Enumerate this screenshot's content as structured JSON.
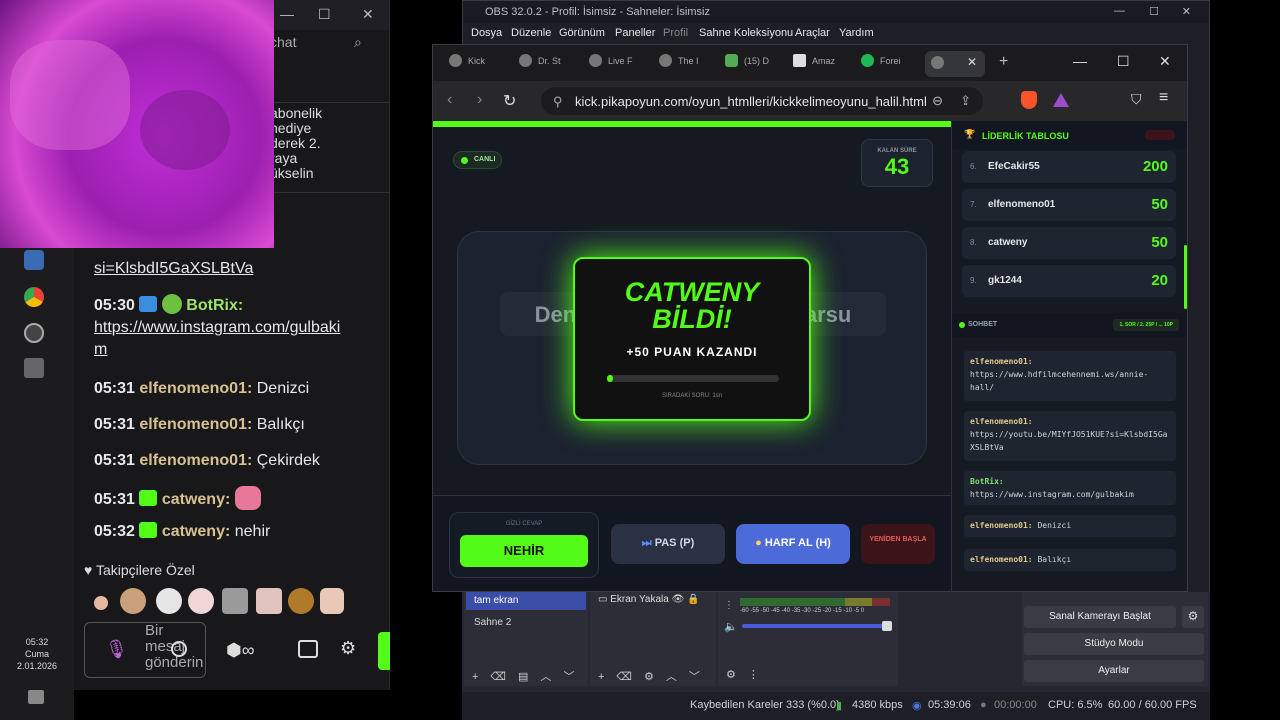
{
  "taskbar": {
    "time": "05:32",
    "day": "Cuma",
    "date": "2.01.2026"
  },
  "chat_panel": {
    "search_placeholder": "chat",
    "notice_lines": [
      "abonelik",
      "hediye",
      "derek 2.",
      "raya",
      "ükselin"
    ],
    "messages": [
      {
        "link": "si=KlsbdI5GaXSLBtVa"
      },
      {
        "time": "05:30",
        "user": "BotRix:",
        "text": "https://www.instagram.com/gulbaki",
        "cont": "m"
      },
      {
        "time": "05:31",
        "user": "elfenomeno01:",
        "text": "Denizci"
      },
      {
        "time": "05:31",
        "user": "elfenomeno01:",
        "text": "Balıkçı"
      },
      {
        "time": "05:31",
        "user": "elfenomeno01:",
        "text": "Çekirdek"
      },
      {
        "time": "05:31",
        "user": "catweny:",
        "text": ""
      },
      {
        "time": "05:32",
        "user": "catweny:",
        "text": "nehir"
      }
    ],
    "followers_label": "Takipçilere Özel",
    "input_placeholder": "Bir mesaj gönderin"
  },
  "obs": {
    "title": "OBS 32.0.2 - Profil: İsimsiz - Sahneler: İsimsiz",
    "menu": [
      "Dosya",
      "Düzenle",
      "Görünüm",
      "Paneller",
      "Profil",
      "Sahne Koleksiyonu",
      "Araçlar",
      "Yardım"
    ],
    "scenes": [
      "tam ekran",
      "Sahne 2"
    ],
    "source": "Ekran Yakala",
    "meter_ticks": "-60 -55 -50 -45 -40 -35 -30 -25 -20 -15 -10 -5 0",
    "controls": [
      "Sanal Kamerayı Başlat",
      "Stüdyo Modu",
      "Ayarlar"
    ],
    "status": {
      "dropped": "Kaybedilen Kareler 333 (%0.0)",
      "bitrate": "4380 kbps",
      "rec_time": "05:39:06",
      "stream_time": "00:00:00",
      "cpu": "CPU: 6.5%",
      "fps": "60.00 / 60.00 FPS"
    }
  },
  "browser": {
    "tabs": [
      "Kick",
      "Dr. St",
      "Live F",
      "The I",
      "(15) D",
      "Amaz",
      "Forei"
    ],
    "url": "kick.pikapoyun.com/oyun_htmlleri/kickkelimeoyunu_halil.html"
  },
  "game": {
    "live_label": "CANLI",
    "time_label": "KALAN SÜRE",
    "time_value": "43",
    "question_text": "Denize dokunan büyük akarsu",
    "winner_line1": "CATWENY",
    "winner_line2": "BİLDİ!",
    "points_text": "+50 PUAN KAZANDI",
    "next_text": "SIRADAKİ SORU: 1sn",
    "hidden_label": "GİZLİ CEVAP",
    "hidden_answer": "NEHİR",
    "btn_pas": "PAS (P)",
    "btn_harf": "HARF AL (H)",
    "btn_reset": "YENİDEN BAŞLA"
  },
  "leaderboard": {
    "title": "LİDERLİK TABLOSU",
    "rows": [
      {
        "rank": "6.",
        "name": "EfeCakir55",
        "score": "200"
      },
      {
        "rank": "7.",
        "name": "elfenomeno01",
        "score": "50"
      },
      {
        "rank": "8.",
        "name": "catweny",
        "score": "50"
      },
      {
        "rank": "9.",
        "name": "gk1244",
        "score": "20"
      }
    ]
  },
  "sohbet": {
    "title": "SOHBET",
    "tag": "1. SOR / 2. 25P / ... 10P",
    "messages": [
      {
        "user": "elfenomeno01:",
        "text": "https://www.hdfilmcehennemi.ws/annie-hall/"
      },
      {
        "user": "elfenomeno01:",
        "text": "https://youtu.be/MIYfJO51KUE?si=KlsbdI5GaXSLBtVa"
      },
      {
        "user": "BotRix:",
        "text": "https://www.instagram.com/gulbakim"
      },
      {
        "user": "elfenomeno01:",
        "text": "Denizci"
      },
      {
        "user": "elfenomeno01:",
        "text": "Balıkçı"
      }
    ]
  }
}
